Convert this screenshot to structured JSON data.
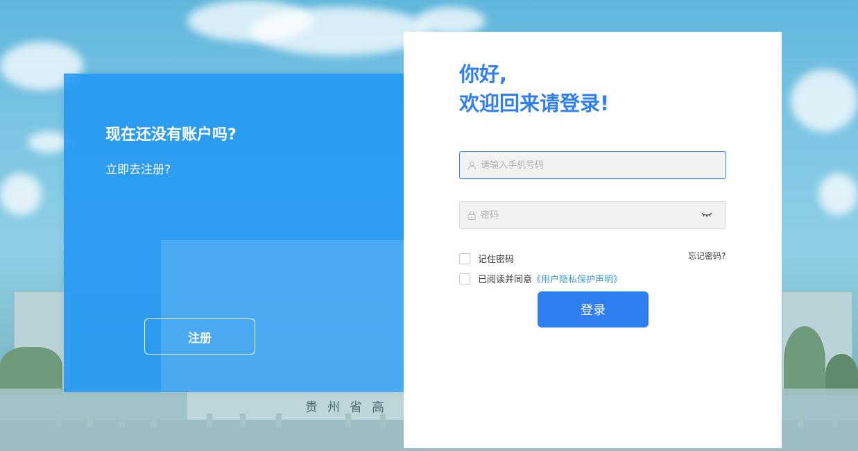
{
  "left_panel": {
    "title": "现在还没有账户吗?",
    "subtitle": "立即去注册?",
    "register_button": "注册"
  },
  "login": {
    "greeting_line1": "你好,",
    "greeting_line2": "欢迎回来请登录!",
    "phone_placeholder": "请输入手机号码",
    "password_placeholder": "密码",
    "remember_label": "记住密码",
    "forgot_label": "忘记密码?",
    "agree_prefix": "已阅读并同意",
    "agree_link": "《用户隐私保护声明》",
    "login_button": "登录"
  },
  "background": {
    "inscription": "贵州省高"
  },
  "colors": {
    "accent": "#2f7ff0",
    "panel_blue": "#2196f3",
    "link": "#3a9ad9"
  },
  "icons": {
    "phone_field": "user-icon",
    "password_field": "lock-icon",
    "password_toggle": "eye-closed-icon"
  }
}
